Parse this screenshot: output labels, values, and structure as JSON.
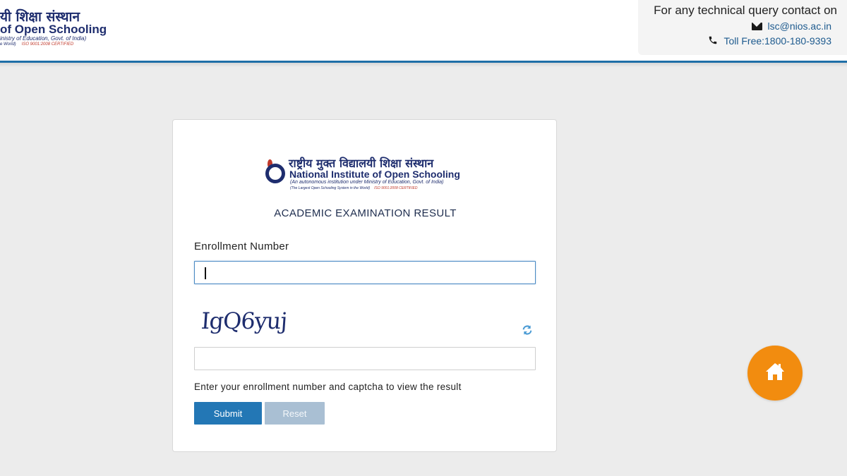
{
  "header": {
    "logo": {
      "hindi": "यी शिक्षा संस्थान",
      "english": "of Open Schooling",
      "sub": "inistry of Education, Govt. of India)",
      "sub2": "e World)",
      "iso": "ISO 9001:2008 CERTIFIED"
    },
    "contact": {
      "title": "For any technical query contact on",
      "email": "lsc@nios.ac.in",
      "phone": "Toll Free:1800-180-9393"
    }
  },
  "card": {
    "logo": {
      "hindi": "राष्ट्रीय मुक्त विद्यालयी शिक्षा संस्थान",
      "english": "National Institute of Open Schooling",
      "sub": "(An autonomous institution under Ministry of Education, Govt. of India)",
      "sub2": "(The Largest Open Schooling System in the World)",
      "iso": "ISO 9001:2008 CERTIFIED"
    },
    "title": "ACADEMIC EXAMINATION RESULT",
    "enrollment_label": "Enrollment Number",
    "enrollment_value": "",
    "captcha_text": "IgQ6yuj",
    "captcha_value": "",
    "help_text": "Enter your enrollment number and captcha to view the result",
    "submit_label": "Submit",
    "reset_label": "Reset"
  },
  "colors": {
    "brand_navy": "#1e2d6e",
    "header_rule": "#1f6fa8",
    "submit": "#2377b5",
    "reset": "#a9bfd3",
    "home_fab": "#f28c0f",
    "link": "#1d5a8e"
  },
  "icons": {
    "email": "envelope-icon",
    "phone": "phone-icon",
    "refresh": "refresh-icon",
    "home": "home-icon"
  }
}
